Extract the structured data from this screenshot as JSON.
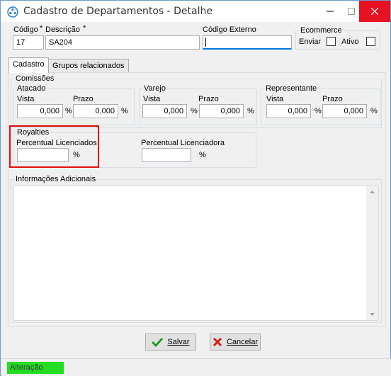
{
  "window": {
    "title": "Cadastro de Departamentos - Detalhe",
    "minimize_icon": "minimize-icon",
    "maximize_icon": "maximize-icon",
    "close_icon": "close-icon"
  },
  "header": {
    "codigo_label": "Código",
    "codigo_required": "*",
    "codigo_value": "17",
    "descricao_label": "Descrição",
    "descricao_required": "*",
    "descricao_value": "SA204",
    "codigo_externo_label": "Código Externo",
    "codigo_externo_value": "",
    "ecommerce_title": "Ecommerce",
    "enviar_label": "Enviar",
    "enviar_checked": false,
    "ativo_label": "Ativo",
    "ativo_checked": false
  },
  "tabs": [
    {
      "label": "Cadastro",
      "active": true
    },
    {
      "label": "Grupos relacionados",
      "active": false
    }
  ],
  "comissoes": {
    "title": "Comissões",
    "atacado": {
      "title": "Atacado",
      "vista_label": "Vista",
      "vista_value": "0,000",
      "prazo_label": "Prazo",
      "prazo_value": "0,000",
      "unit": "%"
    },
    "varejo": {
      "title": "Varejo",
      "vista_label": "Vista",
      "vista_value": "0,000",
      "prazo_label": "Prazo",
      "prazo_value": "0,000",
      "unit": "%"
    },
    "representante": {
      "title": "Representante",
      "vista_label": "Vista",
      "vista_value": "0,000",
      "prazo_label": "Prazo",
      "prazo_value": "0,000",
      "unit": "%"
    }
  },
  "royalties": {
    "title": "Royalties",
    "licenciados_label": "Percentual Licenciados",
    "licenciados_value": "",
    "licenciadora_label": "Percentual Licenciadora",
    "licenciadora_value": "",
    "unit": "%",
    "highlight_color": "#e01010"
  },
  "info": {
    "title": "Informações Adicionais",
    "value": ""
  },
  "buttons": {
    "save_label": "Salvar",
    "save_icon": "checkmark-icon",
    "cancel_label": "Cancelar",
    "cancel_icon": "x-icon"
  },
  "status": {
    "text": "Alteração",
    "color": "#22dd22"
  }
}
